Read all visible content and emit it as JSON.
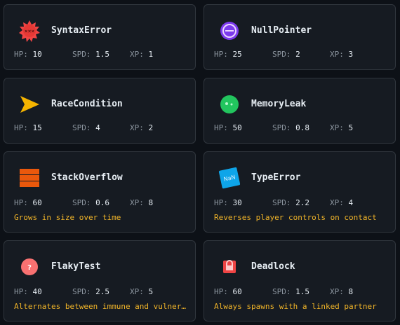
{
  "enemies": [
    {
      "name": "SyntaxError",
      "hp": "10",
      "spd": "1.5",
      "xp": "1",
      "desc": "",
      "icon": "spiky-red-error-icon"
    },
    {
      "name": "NullPointer",
      "hp": "25",
      "spd": "2",
      "xp": "3",
      "desc": "",
      "icon": "purple-circle-minus-icon"
    },
    {
      "name": "RaceCondition",
      "hp": "15",
      "spd": "4",
      "xp": "2",
      "desc": "",
      "icon": "yellow-arrowhead-icon"
    },
    {
      "name": "MemoryLeak",
      "hp": "50",
      "spd": "0.8",
      "xp": "5",
      "desc": "",
      "icon": "green-blob-icon"
    },
    {
      "name": "StackOverflow",
      "hp": "60",
      "spd": "0.6",
      "xp": "8",
      "desc": "Grows in size over time",
      "icon": "orange-stack-icon"
    },
    {
      "name": "TypeError",
      "hp": "30",
      "spd": "2.2",
      "xp": "4",
      "desc": "Reverses player controls on contact",
      "icon": "nan-tile-icon",
      "icon_text": "NaN"
    },
    {
      "name": "FlakyTest",
      "hp": "40",
      "spd": "2.5",
      "xp": "5",
      "desc": "Alternates between immune and vulner…",
      "icon": "red-question-circle-icon",
      "icon_text": "?"
    },
    {
      "name": "Deadlock",
      "hp": "60",
      "spd": "1.5",
      "xp": "8",
      "desc": "Always spawns with a linked partner",
      "icon": "red-lock-icon"
    }
  ],
  "labels": {
    "hp": "HP:",
    "spd": "SPD:",
    "xp": "XP:"
  },
  "colors": {
    "accent_text": "#f0b429",
    "card_bg": "#161b22",
    "border": "#30363d"
  }
}
